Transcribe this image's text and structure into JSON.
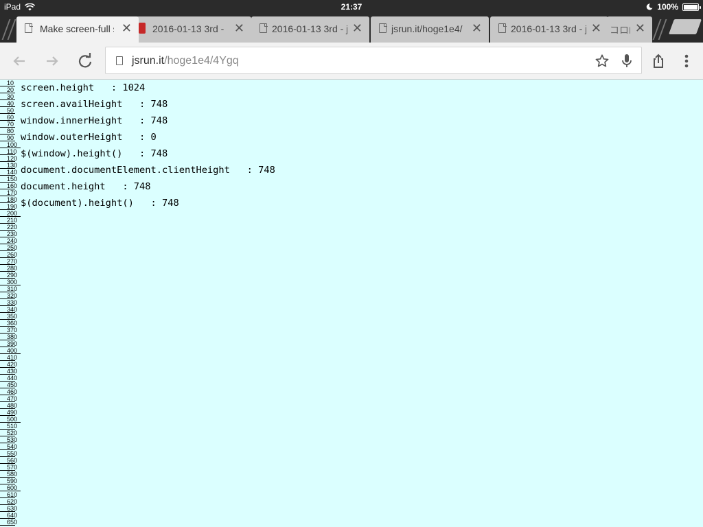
{
  "status_bar": {
    "device": "iPad",
    "time": "21:37",
    "battery": "100%",
    "battery_level": 1.0
  },
  "tabs": [
    {
      "title": "Make screen-full s",
      "active": true
    },
    {
      "title": "2016-01-13 3rd - j",
      "active": false,
      "warning": true
    },
    {
      "title": "2016-01-13 3rd - j",
      "active": false
    },
    {
      "title": "jsrun.it/hoge1e4/",
      "active": false
    },
    {
      "title": "2016-01-13 3rd - j",
      "active": false
    },
    {
      "title": "コロR",
      "active": false
    }
  ],
  "toolbar": {
    "url_host": "jsrun.it",
    "url_path": "/hoge1e4/4Ygq",
    "back_icon": "back-arrow-icon",
    "forward_icon": "forward-arrow-icon",
    "reload_icon": "reload-icon",
    "star_icon": "star-icon",
    "mic_icon": "microphone-icon",
    "share_icon": "share-icon",
    "menu_icon": "kebab-menu-icon"
  },
  "page": {
    "lines": [
      "screen.height   : 1024",
      "screen.availHeight   : 748",
      "window.innerHeight   : 748",
      "window.outerHeight   : 0",
      "$(window).height()   : 748",
      "document.documentElement.clientHeight   : 748",
      "document.height   : 748",
      "$(document).height()   : 748"
    ],
    "ruler_labels": [
      "10",
      "20",
      "30",
      "40",
      "50",
      "60",
      "70",
      "80",
      "90",
      "100",
      "110",
      "120",
      "130",
      "140",
      "150",
      "160",
      "170",
      "180",
      "190",
      "200",
      "210",
      "220",
      "230",
      "240",
      "250",
      "260",
      "270",
      "280",
      "290",
      "300",
      "310",
      "320",
      "330",
      "340",
      "350",
      "360",
      "370",
      "380",
      "390",
      "400",
      "410",
      "420",
      "430",
      "440",
      "450",
      "460",
      "470",
      "480",
      "490",
      "500",
      "510",
      "520",
      "530",
      "540",
      "550",
      "560",
      "570",
      "580",
      "590",
      "600",
      "610",
      "620",
      "630",
      "640",
      "650"
    ]
  },
  "colors": {
    "page_background": "#dbffff",
    "chrome_dark": "#2b2b2b",
    "toolbar": "#f2f2f2"
  }
}
